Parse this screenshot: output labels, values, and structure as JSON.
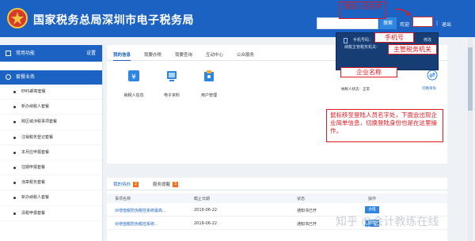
{
  "header": {
    "site_title": "国家税务总局深圳市电子税务局",
    "search_button": "搜索",
    "welcome": "欢迎",
    "separator": "|",
    "logout": "退出"
  },
  "sidebar": {
    "common_functions": "常用功能",
    "settings": "设置",
    "section_title": "套餐业务",
    "items": [
      "EMS邮寄套餐",
      "新办纳税人套餐",
      "跨区域涉税事项套餐",
      "注销税务登记套餐",
      "本月应申报套餐",
      "往期申报套餐",
      "违章税务套餐",
      "新办纳税人套餐",
      "清税申报套餐"
    ]
  },
  "main": {
    "tabs": [
      "我的信息",
      "我要办税",
      "我要查询",
      "互动中心",
      "公众服务"
    ],
    "tiles": [
      "纳税人信息",
      "电子资料",
      "用户管理"
    ],
    "taxpayer_status": "纳税人状态：正常",
    "switch_identity": "切换身份"
  },
  "dropdown": {
    "phone_label": "手机号码：",
    "edit_label": "修改",
    "tax_office_label": "纳税主管税务机关："
  },
  "annotations": {
    "login_name": "登陆人员名字",
    "phone": "手机号",
    "tax_office": "主管税务机关",
    "company_name": "企业名称",
    "note": "鼠标移至登陆人员名字处，下面会出现企业简单信息，切换登陆身份也是在这里操作。"
  },
  "tasks": {
    "tab_todo": "我的待办",
    "tab_todo_count": "2",
    "tab_reminder": "服务提醒",
    "tab_reminder_count": "3",
    "columns": [
      "事项名称",
      "截止日期",
      "状态",
      "操作"
    ],
    "rows": [
      {
        "name": "对增值税防伪税控系统最高…",
        "date": "2019-06-22",
        "status": "通知书已开",
        "action": "办理"
      },
      {
        "name": "对增值税防伪税控系统…",
        "date": "2019-06-22",
        "status": "通知书已开",
        "action": "办理"
      }
    ]
  },
  "watermark": "知乎 @会计教练在线",
  "colors": {
    "header_blue": "#1c62c3",
    "annotation_red": "#e0181f",
    "badge_orange": "#f37021",
    "dropdown_navy": "#173d75"
  }
}
